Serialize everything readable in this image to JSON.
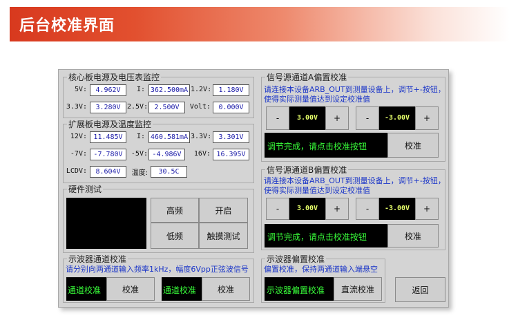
{
  "header": {
    "title": "后台校准界面"
  },
  "core_monitor": {
    "title": "核心板电源及电压表监控",
    "rows": [
      [
        {
          "label": "5V:",
          "value": "4.962V"
        },
        {
          "label": "I:",
          "value": "362.500mA"
        },
        {
          "label": "1.2V:",
          "value": "1.180V"
        }
      ],
      [
        {
          "label": "3.3V:",
          "value": "3.280V"
        },
        {
          "label": "2.5V:",
          "value": "2.500V"
        },
        {
          "label": "Volt:",
          "value": "0.000V"
        }
      ]
    ]
  },
  "ext_monitor": {
    "title": "扩展板电源及温度监控",
    "rows": [
      [
        {
          "label": "12V:",
          "value": "11.485V"
        },
        {
          "label": "I:",
          "value": "460.581mA"
        },
        {
          "label": "3.3V:",
          "value": "3.301V"
        }
      ],
      [
        {
          "label": "-7V:",
          "value": "-7.780V"
        },
        {
          "label": "-5V:",
          "value": "-4.986V"
        },
        {
          "label": "16V:",
          "value": "16.395V"
        }
      ],
      [
        {
          "label": "LCDV:",
          "value": "8.604V"
        },
        {
          "label": "温度:",
          "value": "30.5C"
        }
      ]
    ]
  },
  "hardware_test": {
    "title": "硬件测试",
    "buttons": [
      "高频",
      "开启",
      "低频",
      "触摸测试"
    ]
  },
  "scope_channel": {
    "title": "示波器通道校准",
    "instruction": "请分别向两通道输入频率1kHz，幅度6Vpp正弦波信号",
    "ch1_label": "通道校准",
    "ch1_button": "校准",
    "ch2_label": "通道校准",
    "ch2_button": "校准"
  },
  "channel_a": {
    "title": "信号源通道A偏置校准",
    "instruction_1": "请连接本设备ARB_OUT到测量设备上，调节+-按钮，",
    "instruction_2": "使得实际测量值达到设定校准值",
    "left": {
      "minus": "-",
      "value": "3.00V",
      "plus": "+"
    },
    "right": {
      "minus": "-",
      "value": "-3.00V",
      "plus": "+"
    },
    "status": "调节完成，请点击校准按钮",
    "calibrate": "校准"
  },
  "channel_b": {
    "title": "信号源通道B偏置校准",
    "instruction_1": "请连接本设备ARB_OUT到测量设备上，调节+-按钮，",
    "instruction_2": "使得实际测量值达到设定校准值",
    "left": {
      "minus": "-",
      "value": "3.00V",
      "plus": "+"
    },
    "right": {
      "minus": "-",
      "value": "-3.00V",
      "plus": "+"
    },
    "status": "调节完成，请点击校准按钮",
    "calibrate": "校准"
  },
  "scope_offset": {
    "title": "示波器偏置校准",
    "instruction": "偏置校准，保持两通道输入端悬空",
    "status": "示波器偏置校准",
    "button": "直流校准"
  },
  "return_button": "返回",
  "colors": {
    "banner": "#d8391e",
    "panel": "#d4d4d4",
    "instruction": "#1a35c8",
    "status_green": "#39ff3a",
    "readout": "#e6ff6a"
  }
}
